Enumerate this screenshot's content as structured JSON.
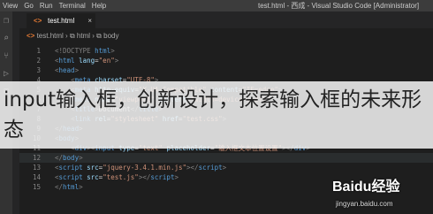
{
  "menubar": {
    "items": [
      "View",
      "Go",
      "Run",
      "Terminal",
      "Help"
    ]
  },
  "window_title": "test.html - 西成 - Visual Studio Code [Administrator]",
  "tab": {
    "label": "test.html",
    "close": "×"
  },
  "breadcrumb": {
    "file": "test.html",
    "node": "html",
    "icon": "<>"
  },
  "editor": {
    "lines": [
      {
        "n": "1",
        "html": "<span class='dim'>&lt;!DOCTYPE</span> <span class='tag'>html</span><span class='dim'>&gt;</span>"
      },
      {
        "n": "2",
        "html": "<span class='dim'>&lt;</span><span class='tag'>html</span> <span class='attr'>lang</span>=<span class='str'>\"en\"</span><span class='dim'>&gt;</span>"
      },
      {
        "n": "3",
        "html": "<span class='dim'>&lt;</span><span class='tag'>head</span><span class='dim'>&gt;</span>"
      },
      {
        "n": "4",
        "html": "    <span class='dim'>&lt;</span><span class='tag'>meta</span> <span class='attr'>charset</span>=<span class='str'>\"UTF-8\"</span><span class='dim'>&gt;</span>"
      },
      {
        "n": "5",
        "html": "    <span class='dim'>&lt;</span><span class='tag'>meta</span> <span class='attr'>http-equiv</span>=<span class='str'>\"X-UA-Compatible\"</span> <span class='attr'>content</span>=<span class='str'>\"IE=edge\"</span><span class='dim'>&gt;</span>"
      },
      {
        "n": "6",
        "html": "    <span class='dim'>&lt;</span><span class='tag'>meta</span> <span class='attr'>name</span>=<span class='str'>\"viewport\"</span> <span class='attr'>content</span>=<span class='str'>\"width=device-width\"</span><span class='dim'>&gt;</span>"
      },
      {
        "n": "7",
        "html": "    <span class='dim'>&lt;</span><span class='tag'>title</span><span class='dim'>&gt;</span><span class='txt'>Document</span><span class='dim'>&lt;/</span><span class='tag'>title</span><span class='dim'>&gt;</span>"
      },
      {
        "n": "8",
        "html": "    <span class='dim'>&lt;</span><span class='tag'>link</span> <span class='attr'>rel</span>=<span class='str'>\"stylesheet\"</span> <span class='attr'>href</span>=<span class='str'>\"test.css\"</span><span class='dim'>&gt;</span>"
      },
      {
        "n": "9",
        "html": "<span class='dim'>&lt;/</span><span class='tag'>head</span><span class='dim'>&gt;</span>"
      },
      {
        "n": "10",
        "html": "<span class='dim'>&lt;</span><span class='tag'>body</span><span class='dim'>&gt;</span>"
      },
      {
        "n": "11",
        "html": "    <span class='dim'>&lt;</span><span class='tag'>div</span><span class='dim'>&gt;&lt;</span><span class='tag'>input</span> <span class='attr'>type</span>=<span class='str'>\"text\"</span> <span class='attr'>placeholder</span>=<span class='str'>\"输入框文本位置设置\"</span><span class='dim'>&gt;&lt;/</span><span class='tag'>div</span><span class='dim'>&gt;</span>"
      },
      {
        "n": "12",
        "html": "<span class='dim'>&lt;/</span><span class='tag'>body</span><span class='dim'>&gt;</span>"
      },
      {
        "n": "13",
        "html": "<span class='dim'>&lt;</span><span class='tag'>script</span> <span class='attr'>src</span>=<span class='str'>\"jquery-3.4.1.min.js\"</span><span class='dim'>&gt;&lt;/</span><span class='tag'>script</span><span class='dim'>&gt;</span>"
      },
      {
        "n": "14",
        "html": "<span class='dim'>&lt;</span><span class='tag'>script</span> <span class='attr'>src</span>=<span class='str'>\"test.js\"</span><span class='dim'>&gt;&lt;/</span><span class='tag'>script</span><span class='dim'>&gt;</span>"
      },
      {
        "n": "15",
        "html": "<span class='dim'>&lt;/</span><span class='tag'>html</span><span class='dim'>&gt;</span>"
      }
    ],
    "cursor_line": "12"
  },
  "overlay": {
    "caption": "input输入框，创新设计，探索输入框的未来形态"
  },
  "watermark": {
    "logo": "Baidu经验",
    "url": "jingyan.baidu.com"
  },
  "colors": {
    "editor_bg": "#1e1e1e",
    "tag": "#569cd6",
    "attr": "#9cdcfe",
    "string": "#ce9178",
    "html_icon": "#e37933"
  }
}
